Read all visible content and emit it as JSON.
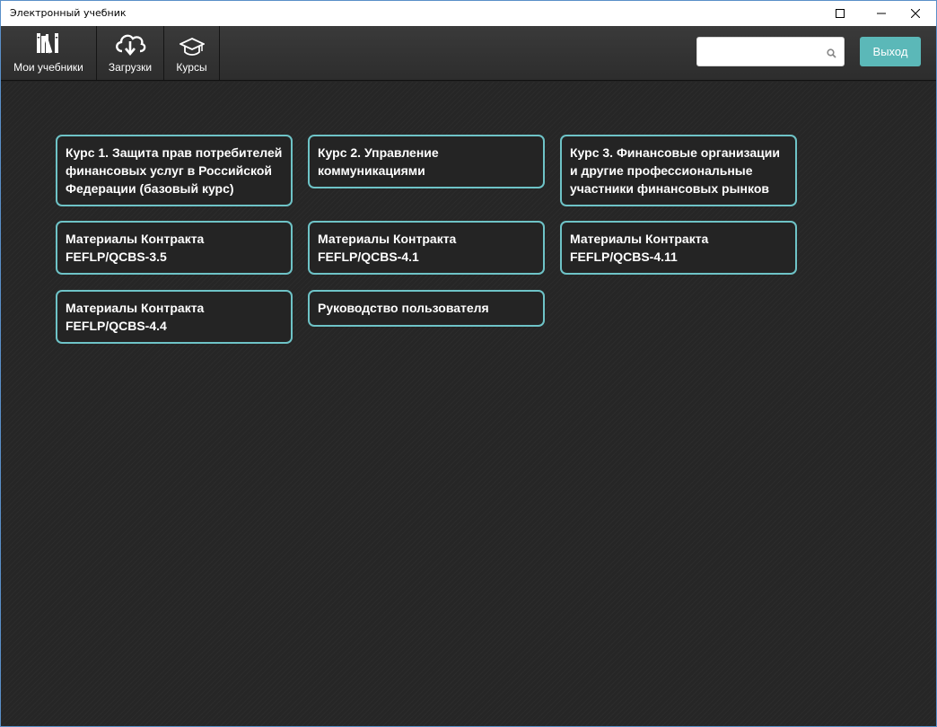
{
  "window": {
    "title": "Электронный учебник"
  },
  "toolbar": {
    "nav": [
      {
        "label": "Мои учебники",
        "icon": "books-icon"
      },
      {
        "label": "Загрузки",
        "icon": "cloud-download-icon"
      },
      {
        "label": "Курсы",
        "icon": "graduation-cap-icon"
      }
    ],
    "search": {
      "value": "",
      "placeholder": "",
      "icon": "search-icon"
    },
    "exit_label": "Выход"
  },
  "courses": [
    {
      "title": "Курс 1. Защита прав потребителей финансовых услуг в Российской Федерации (базовый курс)"
    },
    {
      "title": "Курс 2. Управление коммуникациями"
    },
    {
      "title": "Курс 3. Финансовые организации и другие профессиональные участники финансовых рынков"
    },
    {
      "title": "Материалы Контракта FEFLP/QCBS-3.5"
    },
    {
      "title": "Материалы Контракта FEFLP/QCBS-4.1"
    },
    {
      "title": "Материалы Контракта FEFLP/QCBS-4.11"
    },
    {
      "title": "Материалы Контракта FEFLP/QCBS-4.4"
    },
    {
      "title": "Руководство пользователя"
    }
  ],
  "colors": {
    "accent": "#6ec3c7",
    "exit_button": "#5bb8b8",
    "background": "#262626"
  }
}
